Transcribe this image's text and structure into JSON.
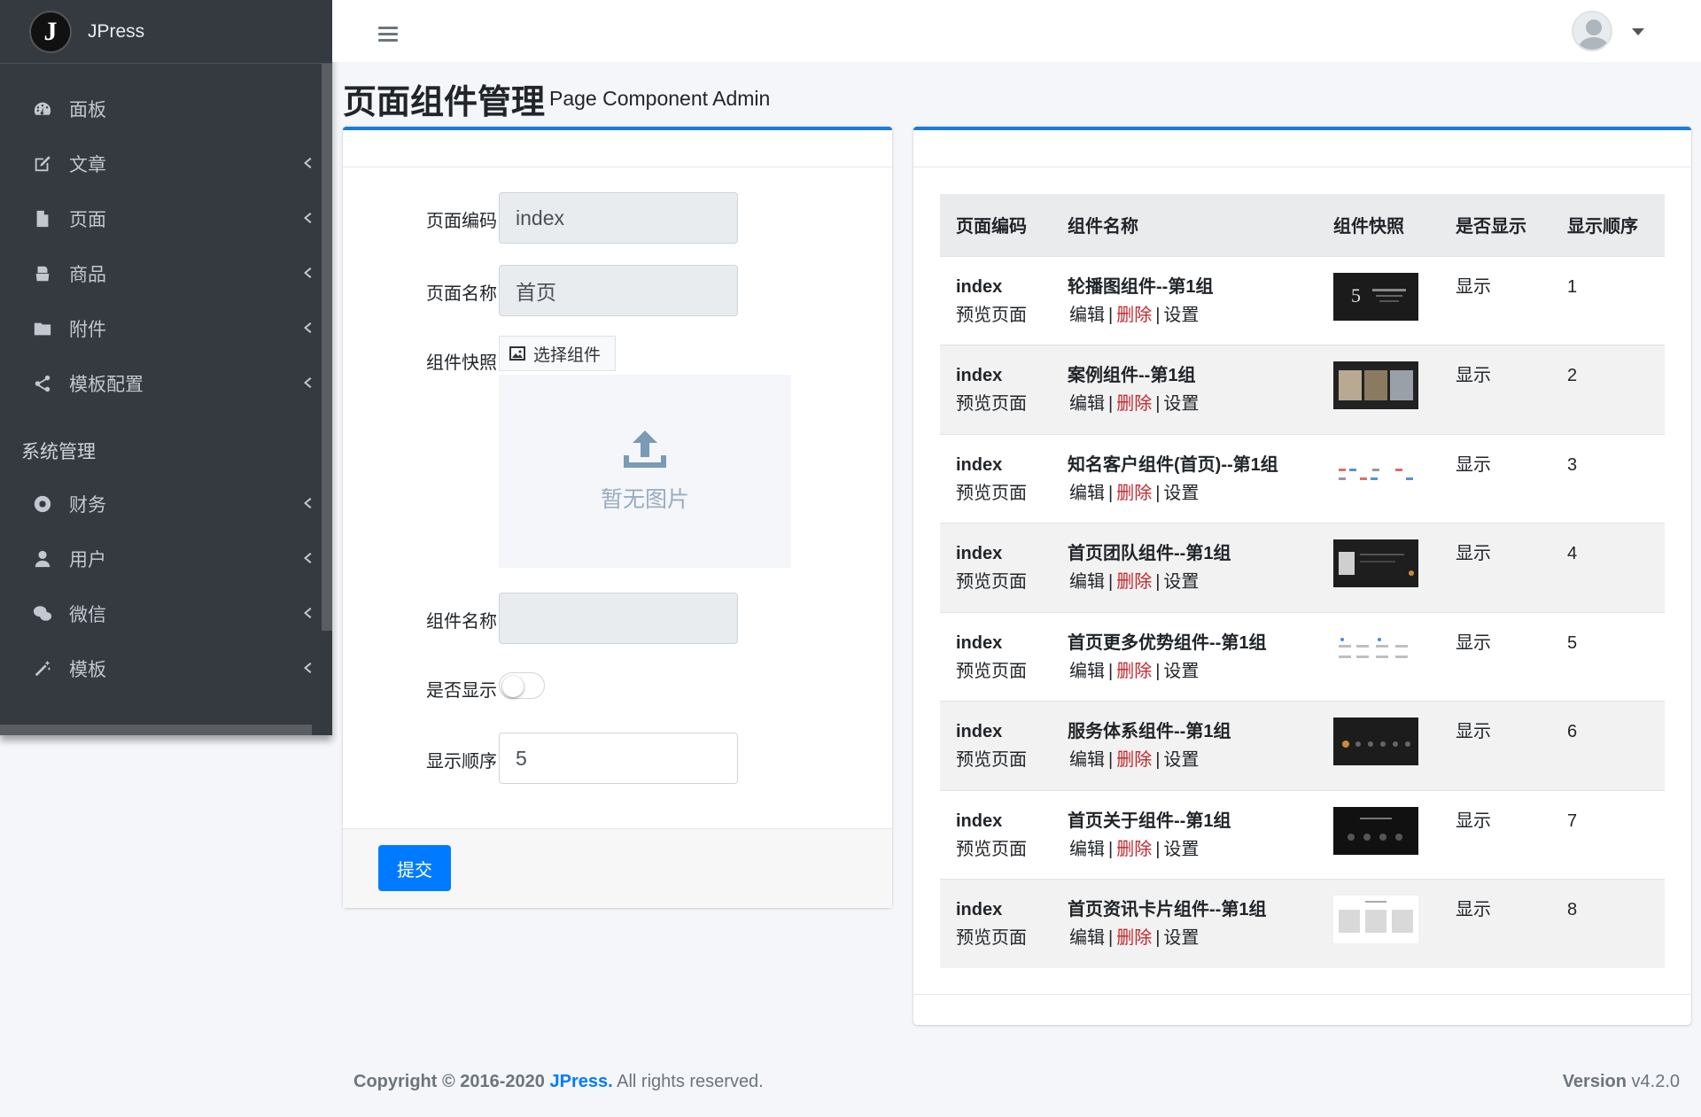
{
  "brand": {
    "logo_letter": "J",
    "name": "JPress"
  },
  "sidebar": {
    "items": [
      {
        "label": "面板",
        "icon": "dashboard-icon",
        "has_submenu": false
      },
      {
        "label": "文章",
        "icon": "edit-icon",
        "has_submenu": true
      },
      {
        "label": "页面",
        "icon": "file-icon",
        "has_submenu": true
      },
      {
        "label": "商品",
        "icon": "shopping-bag-icon",
        "has_submenu": true
      },
      {
        "label": "附件",
        "icon": "folder-icon",
        "has_submenu": true
      },
      {
        "label": "模板配置",
        "icon": "share-icon",
        "has_submenu": true
      }
    ],
    "section_header": "系统管理",
    "system_items": [
      {
        "label": "财务",
        "icon": "finance-icon",
        "has_submenu": true
      },
      {
        "label": "用户",
        "icon": "user-icon",
        "has_submenu": true
      },
      {
        "label": "微信",
        "icon": "wechat-icon",
        "has_submenu": true
      },
      {
        "label": "模板",
        "icon": "magic-wand-icon",
        "has_submenu": true
      }
    ]
  },
  "header": {
    "title": "页面组件管理",
    "subtitle": "Page Component Admin"
  },
  "form": {
    "page_code_label": "页面编码",
    "page_code_value": "index",
    "page_name_label": "页面名称",
    "page_name_value": "首页",
    "snapshot_label": "组件快照",
    "pick_button": "选择组件",
    "no_image": "暂无图片",
    "component_name_label": "组件名称",
    "component_name_value": "",
    "show_label": "是否显示",
    "show_value": false,
    "order_label": "显示顺序",
    "order_value": "5",
    "submit_label": "提交"
  },
  "table": {
    "columns": [
      "页面编码",
      "组件名称",
      "组件快照",
      "是否显示",
      "显示顺序"
    ],
    "preview_label": "预览页面",
    "edit_label": "编辑",
    "delete_label": "删除",
    "settings_label": "设置",
    "separator": "|",
    "rows": [
      {
        "page_code": "index",
        "component_name": "轮播图组件--第1组",
        "thumb_style": "dark-slide",
        "show": "显示",
        "order": "1"
      },
      {
        "page_code": "index",
        "component_name": "案例组件--第1组",
        "thumb_style": "dark-cases",
        "show": "显示",
        "order": "2"
      },
      {
        "page_code": "index",
        "component_name": "知名客户组件(首页)--第1组",
        "thumb_style": "light-logos",
        "show": "显示",
        "order": "3"
      },
      {
        "page_code": "index",
        "component_name": "首页团队组件--第1组",
        "thumb_style": "dark-team",
        "show": "显示",
        "order": "4"
      },
      {
        "page_code": "index",
        "component_name": "首页更多优势组件--第1组",
        "thumb_style": "light-icons",
        "show": "显示",
        "order": "5"
      },
      {
        "page_code": "index",
        "component_name": "服务体系组件--第1组",
        "thumb_style": "dark-service",
        "show": "显示",
        "order": "6"
      },
      {
        "page_code": "index",
        "component_name": "首页关于组件--第1组",
        "thumb_style": "dark-about",
        "show": "显示",
        "order": "7"
      },
      {
        "page_code": "index",
        "component_name": "首页资讯卡片组件--第1组",
        "thumb_style": "light-cards",
        "show": "显示",
        "order": "8"
      }
    ]
  },
  "footer": {
    "copyright_prefix": "Copyright © 2016-2020",
    "brand_link": "JPress.",
    "rights": "All rights reserved.",
    "version_label": "Version",
    "version_value": "v4.2.0"
  },
  "colors": {
    "sidebar_bg": "#343a40",
    "accent": "#007bff",
    "delete_link": "#c0282e"
  }
}
